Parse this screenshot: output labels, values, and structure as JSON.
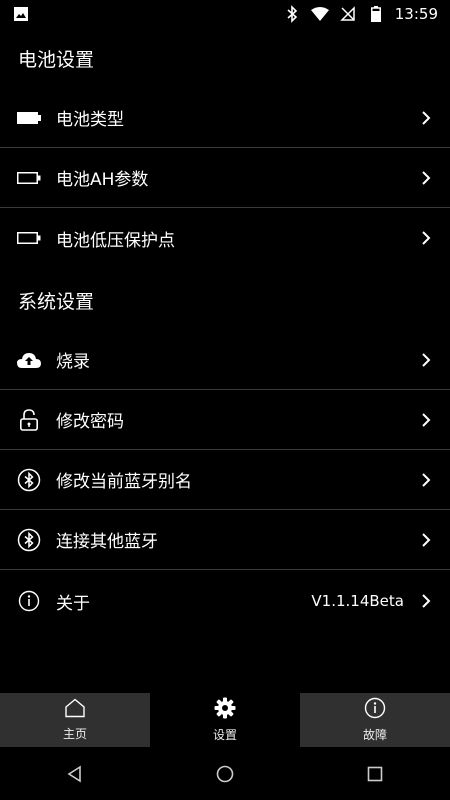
{
  "status": {
    "time": "13:59"
  },
  "sections": {
    "battery": {
      "title": "电池设置",
      "items": [
        {
          "label": "电池类型",
          "icon": "battery-full-icon"
        },
        {
          "label": "电池AH参数",
          "icon": "battery-empty-icon"
        },
        {
          "label": "电池低压保护点",
          "icon": "battery-empty-icon"
        }
      ]
    },
    "system": {
      "title": "系统设置",
      "items": [
        {
          "label": "烧录",
          "icon": "cloud-upload-icon"
        },
        {
          "label": "修改密码",
          "icon": "lock-icon"
        },
        {
          "label": "修改当前蓝牙别名",
          "icon": "bluetooth-icon"
        },
        {
          "label": "连接其他蓝牙",
          "icon": "bluetooth-icon"
        },
        {
          "label": "关于",
          "icon": "info-icon",
          "value": "V1.1.14Beta"
        }
      ]
    }
  },
  "bottom_nav": {
    "items": [
      {
        "label": "主页",
        "icon": "home-icon"
      },
      {
        "label": "设置",
        "icon": "gear-icon",
        "active": true
      },
      {
        "label": "故障",
        "icon": "info-icon"
      }
    ]
  },
  "colors": {
    "background": "#000000",
    "nav_bg": "#303030",
    "divider": "#3a3a3a"
  }
}
